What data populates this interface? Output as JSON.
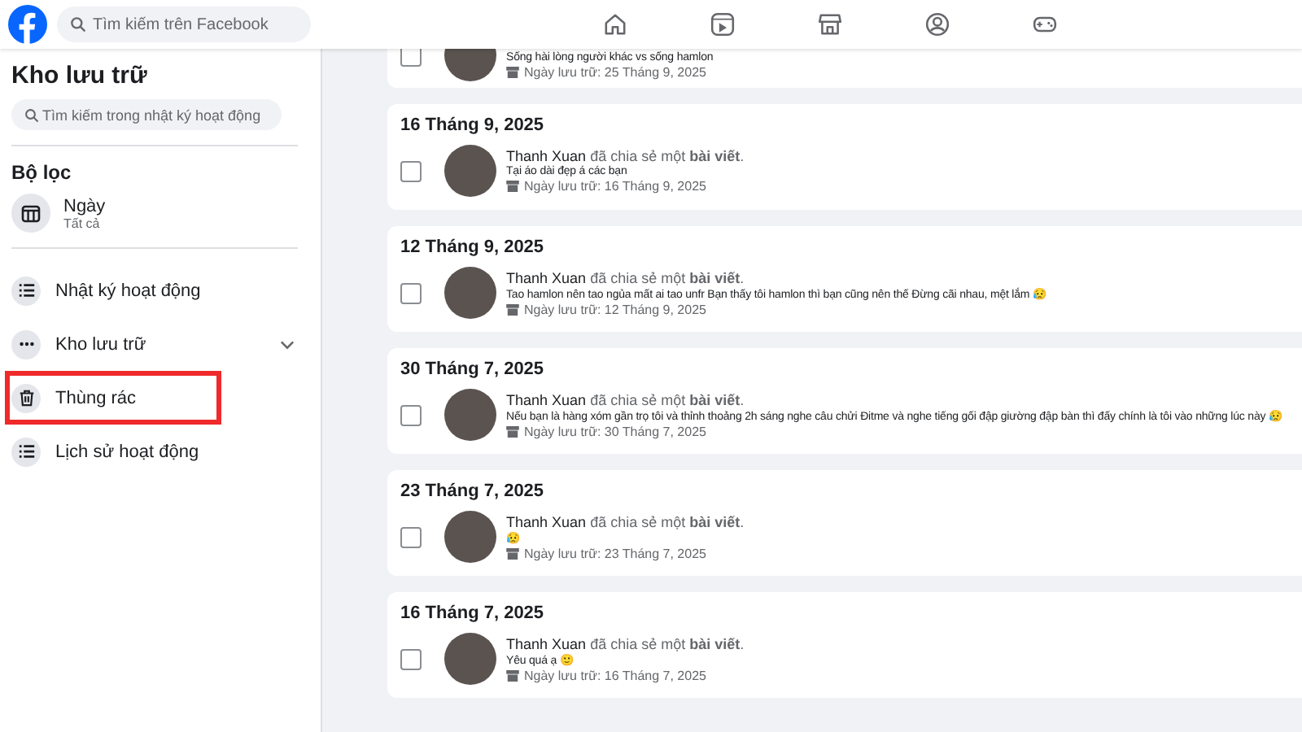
{
  "topbar": {
    "search": {
      "placeholder": "Tìm kiếm trên Facebook"
    },
    "nav": [
      {
        "kind": "home"
      },
      {
        "kind": "video"
      },
      {
        "kind": "store"
      },
      {
        "kind": "people"
      },
      {
        "kind": "game"
      }
    ]
  },
  "sidebar": {
    "title": "Kho lưu trữ",
    "search": {
      "placeholder": "Tìm kiếm trong nhật ký hoạt động"
    },
    "filter_heading": "Bộ lọc",
    "filter": {
      "label": "Ngày",
      "value": "Tất cả"
    },
    "items": [
      {
        "kind": "list",
        "label": "Nhật ký hoạt động",
        "expandable": false,
        "highlighted": false
      },
      {
        "kind": "more",
        "label": "Kho lưu trữ",
        "expandable": true,
        "highlighted": false
      },
      {
        "kind": "trash",
        "label": "Thùng rác",
        "expandable": false,
        "highlighted": true
      },
      {
        "kind": "list",
        "label": "Lịch sử hoạt động",
        "expandable": false,
        "highlighted": false
      }
    ]
  },
  "groups": [
    {
      "items": [
        {
          "checked": false,
          "text": "Sống hài lòng người khác vs sống hamlon",
          "archived": "Ngày lưu trữ: 25 Tháng 9, 2025"
        }
      ]
    },
    {
      "date": "16 Tháng 9, 2025",
      "items": [
        {
          "checked": false,
          "actor": "Thanh Xuan",
          "summary": "đã chia sẻ một **bài viết**.",
          "text": "Tại áo dài đẹp á các bạn",
          "archived": "Ngày lưu trữ: 16 Tháng 9, 2025"
        }
      ]
    },
    {
      "date": "12 Tháng 9, 2025",
      "items": [
        {
          "checked": false,
          "actor": "Thanh Xuan",
          "summary": "đã chia sẻ một **bài viết**.",
          "text": "Tao hamlon nên tao ngủa mất ai tao unfr Bạn thấy tôi hamlon thì bạn cũng nên thế Đừng cãi nhau, mệt lắm 😥",
          "archived": "Ngày lưu trữ: 12 Tháng 9, 2025"
        }
      ]
    },
    {
      "date": "30 Tháng 7, 2025",
      "items": [
        {
          "checked": false,
          "actor": "Thanh Xuan",
          "summary": "đã chia sẻ một **bài viết**.",
          "text": "Nếu bạn là hàng xóm gần trọ tôi và thỉnh thoảng 2h sáng nghe câu chửi Đitme và nghe tiếng gối đập giường đập bàn thì đấy chính là tôi vào những lúc này 😥",
          "archived": "Ngày lưu trữ: 30 Tháng 7, 2025"
        }
      ]
    },
    {
      "date": "23 Tháng 7, 2025",
      "items": [
        {
          "checked": false,
          "actor": "Thanh Xuan",
          "summary": "đã chia sẻ một **bài viết**.",
          "text": "😥",
          "archived": "Ngày lưu trữ: 23 Tháng 7, 2025"
        }
      ]
    },
    {
      "date": "16 Tháng 7, 2025",
      "items": [
        {
          "checked": false,
          "actor": "Thanh Xuan",
          "summary": "đã chia sẻ một **bài viết**.",
          "text": "Yêu quá ạ 🙂",
          "archived": "Ngày lưu trữ: 16 Tháng 7, 2025"
        }
      ]
    }
  ]
}
